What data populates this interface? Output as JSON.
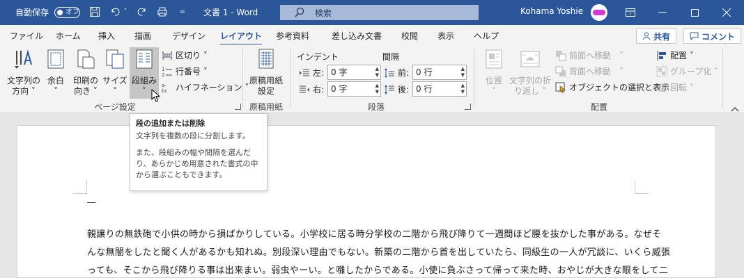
{
  "titlebar": {
    "autosave_label": "自動保存",
    "autosave_state": "オフ",
    "doc_title": "文書 1  -  Word",
    "search_placeholder": "検索",
    "user_name": "Kohama Yoshie"
  },
  "tabs": [
    "ファイル",
    "ホーム",
    "挿入",
    "描画",
    "デザイン",
    "レイアウト",
    "参考資料",
    "差し込み文書",
    "校閲",
    "表示",
    "ヘルプ"
  ],
  "active_tab": "レイアウト",
  "share_label": "共有",
  "comment_label": "コメント",
  "ribbon": {
    "page_setup": {
      "text_direction": [
        "文字列の",
        "方向 ˅"
      ],
      "margins": [
        "余白",
        "˅"
      ],
      "orientation": [
        "印刷の",
        "向き ˅"
      ],
      "size": [
        "サイズ",
        "˅"
      ],
      "columns": [
        "段組み",
        "˅"
      ],
      "breaks": "区切り ˅",
      "line_numbers": "行番号 ˅",
      "hyphenation": "ハイフネーション ˅",
      "group_label": "ページ設定"
    },
    "manuscript": {
      "button": [
        "原稿用紙",
        "設定"
      ],
      "group_label": "原稿用紙"
    },
    "paragraph": {
      "indent_header": "インデント",
      "spacing_header": "間隔",
      "left_label": "左:",
      "right_label": "右:",
      "before_label": "前:",
      "after_label": "後:",
      "left_value": "0 字",
      "right_value": "0 字",
      "before_value": "0 行",
      "after_value": "0 行",
      "group_label": "段落"
    },
    "arrange": {
      "position": [
        "位置",
        "˅"
      ],
      "wrap_text": [
        "文字列の折",
        "り返し ˅"
      ],
      "bring_forward": "前面へ移動",
      "send_backward": "背面へ移動",
      "selection_pane": "オブジェクトの選択と表示",
      "align": "配置 ˅",
      "group": "グループ化 ˅",
      "rotate": "回転 ˅",
      "group_label": "配置"
    }
  },
  "tooltip": {
    "title": "段の追加または削除",
    "line1": "文字列を複数の段に分割します。",
    "line2": "また、段組みの幅や間隔を選んだり、あらかじめ用意された書式の中から選ぶこともできます。"
  },
  "document": {
    "lines": [
      "親譲りの無鉄砲で小供の時から損ばかりしている。小学校に居る時分学校の二階から飛び降りて一週間ほど腰を抜かした事がある。なぜそ",
      "んな無闇をしたと聞く人があるかも知れぬ。別段深い理由でもない。新築の二階から首を出していたら、同級生の一人が冗談に、いくら威張",
      "っても、そこから飛び降りる事は出来まい。弱虫やーい。と囃したからである。小使に負ぶさって帰って来た時、おやじが大きな眼をして二"
    ]
  }
}
